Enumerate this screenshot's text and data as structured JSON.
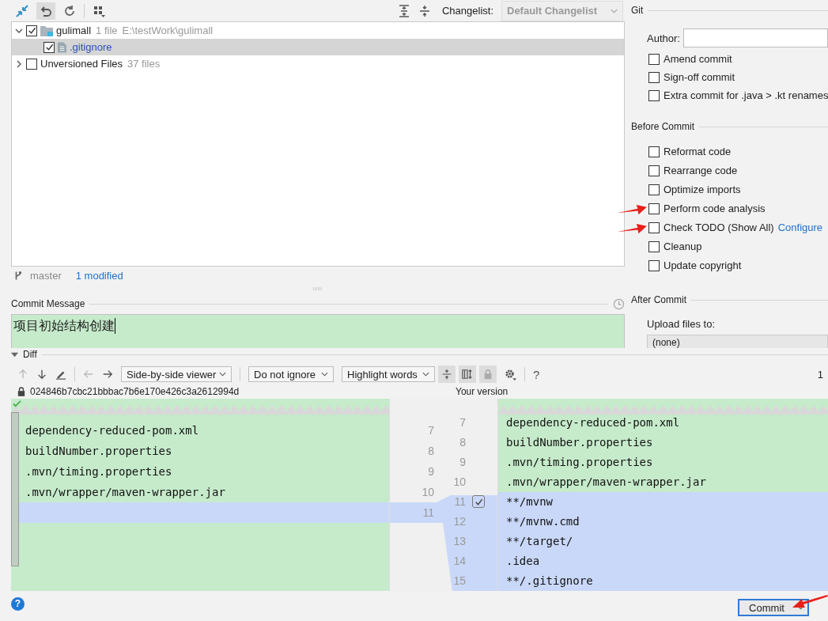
{
  "toolbar": {
    "changelist_label": "Changelist:",
    "changelist": "Default Changelist"
  },
  "changes": [
    {
      "kind": "module",
      "label": "gulimall",
      "info": "1 file",
      "path": "E:\\testWork\\gulimall",
      "checked": true,
      "expanded": true,
      "selected": false,
      "children": [
        {
          "kind": "file",
          "label": ".gitignore",
          "checked": true,
          "selected": true
        }
      ]
    },
    {
      "kind": "group",
      "label": "Unversioned Files",
      "info": "37 files",
      "checked": false,
      "expanded": false,
      "selected": false
    }
  ],
  "status": {
    "branch": "master",
    "modified": "1 modified"
  },
  "commit_message": {
    "label": "Commit Message",
    "value": "项目初始结构创建"
  },
  "git": {
    "title": "Git",
    "author_label": "Author:",
    "options": [
      {
        "label": "Amend commit",
        "checked": false
      },
      {
        "label": "Sign-off commit",
        "checked": false
      },
      {
        "label": "Extra commit for .java > .kt renames",
        "checked": false
      }
    ]
  },
  "before_commit": {
    "title": "Before Commit",
    "options": [
      {
        "label": "Reformat code",
        "checked": false
      },
      {
        "label": "Rearrange code",
        "checked": false
      },
      {
        "label": "Optimize imports",
        "checked": false
      },
      {
        "label": "Perform code analysis",
        "checked": false
      },
      {
        "label": "Check TODO (Show All)",
        "link": "Configure",
        "checked": false
      },
      {
        "label": "Cleanup",
        "checked": false
      },
      {
        "label": "Update copyright",
        "checked": false
      }
    ]
  },
  "after_commit": {
    "title": "After Commit",
    "upload_label": "Upload files to:",
    "upload_target": "(none)"
  },
  "diff": {
    "title": "Diff",
    "expanded": true,
    "viewer": "Side-by-side viewer",
    "ignore": "Do not ignore",
    "highlight": "Highlight words",
    "count": "1",
    "left_title": "024846b7cbc21bbbac7b6e170e426c3a2612994d",
    "right_title": "Your version",
    "change_included": true,
    "help": "?",
    "left_lines": [
      {
        "number": "7",
        "text": "dependency-reduced-pom.xml",
        "kind": "same"
      },
      {
        "number": "8",
        "text": "buildNumber.properties",
        "kind": "same"
      },
      {
        "number": "9",
        "text": ".mvn/timing.properties",
        "kind": "same"
      },
      {
        "number": "10",
        "text": ".mvn/wrapper/maven-wrapper.jar",
        "kind": "same"
      },
      {
        "number": "11",
        "kind": "changed"
      }
    ],
    "right_lines": [
      {
        "number": "7",
        "text": "dependency-reduced-pom.xml",
        "kind": "same"
      },
      {
        "number": "8",
        "text": "buildNumber.properties",
        "kind": "same"
      },
      {
        "number": "9",
        "text": ".mvn/timing.properties",
        "kind": "same"
      },
      {
        "number": "10",
        "text": ".mvn/wrapper/maven-wrapper.jar",
        "kind": "same"
      },
      {
        "number": "11",
        "text": "**/mvnw",
        "kind": "changed"
      },
      {
        "number": "12",
        "text": "**/mvnw.cmd",
        "kind": "changed"
      },
      {
        "number": "13",
        "text": "**/target/",
        "kind": "changed"
      },
      {
        "number": "14",
        "text": ".idea",
        "kind": "changed"
      },
      {
        "number": "15",
        "text": "**/.gitignore",
        "kind": "changed"
      }
    ]
  },
  "commit_button": "Commit",
  "help": "?"
}
